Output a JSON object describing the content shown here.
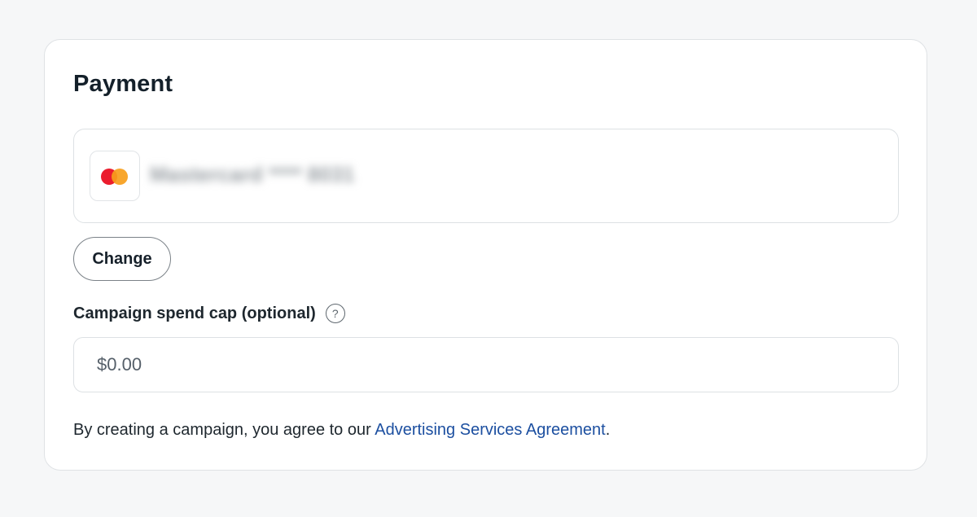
{
  "payment": {
    "title": "Payment",
    "method": {
      "icon": "mastercard-logo-icon",
      "label": "Mastercard **** 8031",
      "brand_colors": {
        "red": "#eb1c2d",
        "orange": "#f79e1b"
      }
    },
    "change_label": "Change"
  },
  "spend_cap": {
    "label": "Campaign spend cap (optional)",
    "help_icon": "question-circle-icon",
    "help_glyph": "?",
    "placeholder": "$0.00",
    "value": ""
  },
  "agreement": {
    "prefix": "By creating a campaign, you agree to our ",
    "link_text": "Advertising Services Agreement",
    "suffix": "."
  },
  "colors": {
    "link": "#1c4fa0",
    "border": "#dde1e4",
    "background": "#f6f7f8"
  }
}
